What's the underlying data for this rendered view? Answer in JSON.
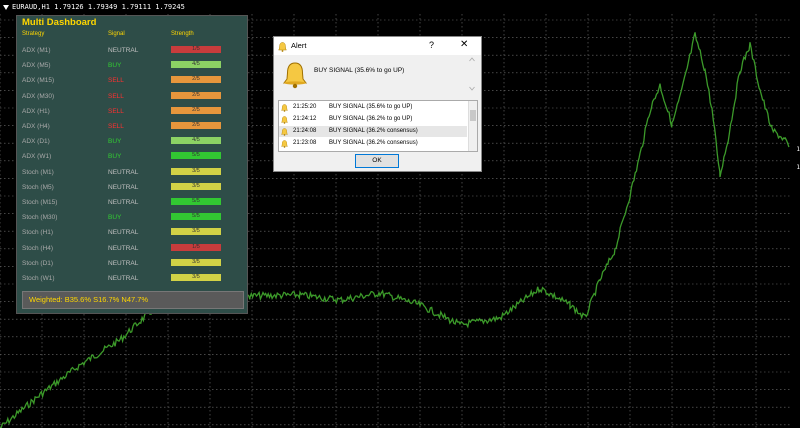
{
  "symbol_bar": {
    "text": "EURAUD,H1  1.79126 1.79349 1.79111 1.79245"
  },
  "price_ticks": [
    "1",
    "1"
  ],
  "colors": {
    "buy": "#32cd32",
    "sell": "#ff3030",
    "neutral": "#c0c0c0",
    "bar_red": "#c83c3c",
    "bar_green": "#32c832",
    "bar_lightgreen": "#8cd264",
    "bar_orange": "#e6963c",
    "bar_yellow": "#d2d246",
    "chart_line": "#3c9a2a"
  },
  "dashboard": {
    "title": "Multi Dashboard",
    "headers": {
      "strategy": "Strategy",
      "signal": "Signal",
      "strength": "Strength"
    },
    "rows": [
      {
        "strategy": "ADX (M1)",
        "signal": "NEUTRAL",
        "strength": "1/5",
        "sig_color": "#c0c0c0",
        "bar_color": "#c83c3c"
      },
      {
        "strategy": "ADX (M5)",
        "signal": "BUY",
        "strength": "4/5",
        "sig_color": "#32cd32",
        "bar_color": "#8cd264"
      },
      {
        "strategy": "ADX (M15)",
        "signal": "SELL",
        "strength": "2/5",
        "sig_color": "#ff3030",
        "bar_color": "#e6963c"
      },
      {
        "strategy": "ADX (M30)",
        "signal": "SELL",
        "strength": "2/5",
        "sig_color": "#ff3030",
        "bar_color": "#e6963c"
      },
      {
        "strategy": "ADX (H1)",
        "signal": "SELL",
        "strength": "2/5",
        "sig_color": "#ff3030",
        "bar_color": "#e6963c"
      },
      {
        "strategy": "ADX (H4)",
        "signal": "SELL",
        "strength": "2/5",
        "sig_color": "#ff3030",
        "bar_color": "#e6963c"
      },
      {
        "strategy": "ADX (D1)",
        "signal": "BUY",
        "strength": "4/5",
        "sig_color": "#32cd32",
        "bar_color": "#8cd264"
      },
      {
        "strategy": "ADX (W1)",
        "signal": "BUY",
        "strength": "5/5",
        "sig_color": "#32cd32",
        "bar_color": "#32c832"
      },
      {
        "strategy": "Stoch (M1)",
        "signal": "NEUTRAL",
        "strength": "3/5",
        "sig_color": "#c0c0c0",
        "bar_color": "#d2d246"
      },
      {
        "strategy": "Stoch (M5)",
        "signal": "NEUTRAL",
        "strength": "3/5",
        "sig_color": "#c0c0c0",
        "bar_color": "#d2d246"
      },
      {
        "strategy": "Stoch (M15)",
        "signal": "NEUTRAL",
        "strength": "5/5",
        "sig_color": "#c0c0c0",
        "bar_color": "#32c832"
      },
      {
        "strategy": "Stoch (M30)",
        "signal": "BUY",
        "strength": "5/5",
        "sig_color": "#32cd32",
        "bar_color": "#32c832"
      },
      {
        "strategy": "Stoch (H1)",
        "signal": "NEUTRAL",
        "strength": "3/5",
        "sig_color": "#c0c0c0",
        "bar_color": "#d2d246"
      },
      {
        "strategy": "Stoch (H4)",
        "signal": "NEUTRAL",
        "strength": "1/5",
        "sig_color": "#c0c0c0",
        "bar_color": "#c83c3c"
      },
      {
        "strategy": "Stoch (D1)",
        "signal": "NEUTRAL",
        "strength": "3/5",
        "sig_color": "#c0c0c0",
        "bar_color": "#d2d246"
      },
      {
        "strategy": "Stoch (W1)",
        "signal": "NEUTRAL",
        "strength": "3/5",
        "sig_color": "#c0c0c0",
        "bar_color": "#d2d246"
      }
    ],
    "footer": "Weighted: B35.6% S16.7% N47.7%"
  },
  "alert": {
    "title": "Alert",
    "help": "?",
    "close": "✕",
    "message": "BUY SIGNAL (35.6% to go UP)",
    "list": [
      {
        "time": "21:25:20",
        "msg": "BUY SIGNAL (35.6% to go UP)",
        "bg": "#ffffff"
      },
      {
        "time": "21:24:12",
        "msg": "BUY SIGNAL (36.2% to go UP)",
        "bg": "#ffffff"
      },
      {
        "time": "21:24:08",
        "msg": "BUY SIGNAL (36.2% consensus)",
        "bg": "#e6e6e6"
      },
      {
        "time": "21:23:08",
        "msg": "BUY SIGNAL (36.2% consensus)",
        "bg": "#ffffff"
      }
    ],
    "ok_label": "OK"
  }
}
